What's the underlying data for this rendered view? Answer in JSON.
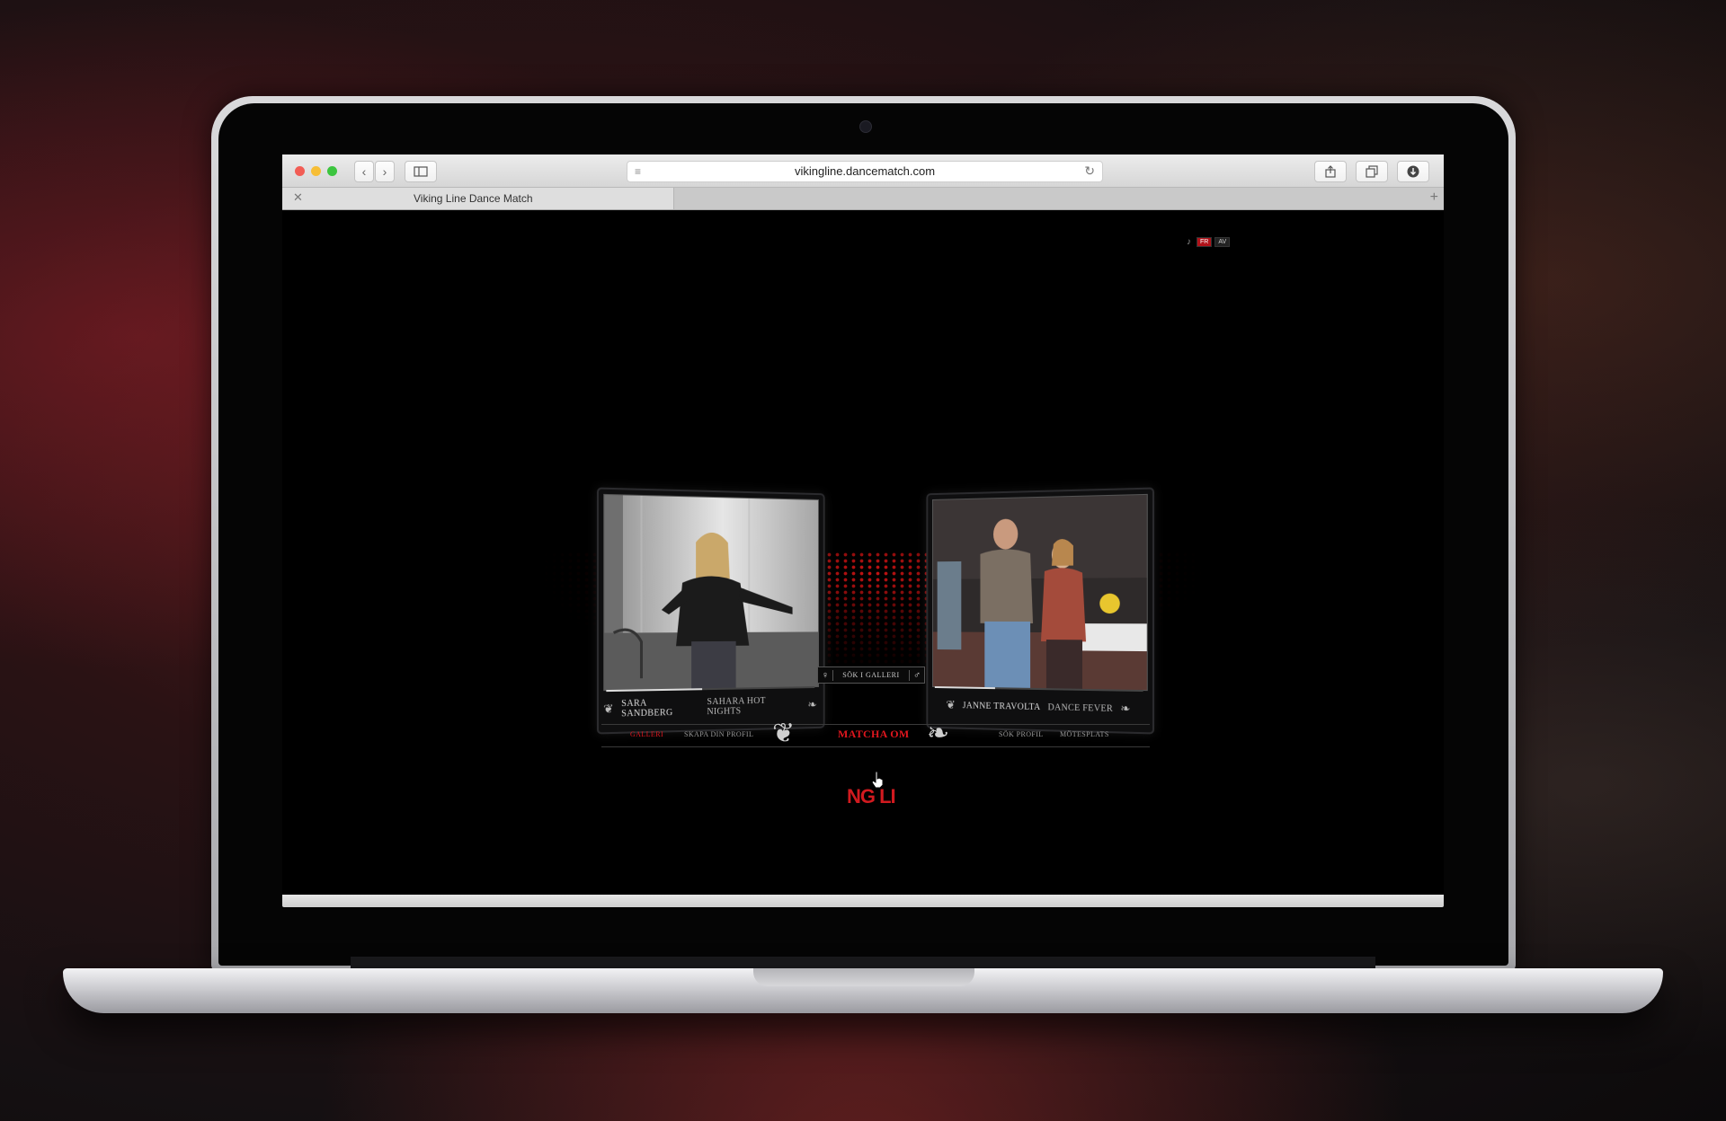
{
  "browser": {
    "url": "vikingline.dancematch.com",
    "tab_title": "Viking Line Dance Match",
    "icons": {
      "back": "chevron-left-icon",
      "forward": "chevron-right-icon",
      "sidebar": "sidebar-icon",
      "share": "share-icon",
      "tabs": "tabs-overview-icon",
      "download": "download-icon",
      "reload": "reload-icon",
      "reader": "reader-icon"
    }
  },
  "page": {
    "language": {
      "items": [
        "FR",
        "AV"
      ],
      "active": "FR"
    },
    "cards": [
      {
        "dancer": "SARA SANDBERG",
        "song": "SAHARA HOT NIGHTS",
        "progress": 0.45
      },
      {
        "dancer": "JANNE TRAVOLTA",
        "song": "DANCE FEVER",
        "progress": 0.3
      }
    ],
    "search_gallery": "SÖK I GALLERI",
    "nav": {
      "items": [
        "GALLERI",
        "SKAPA DIN PROFIL",
        "SÖK PROFIL",
        "MÖTESPLATS"
      ],
      "active": "GALLERI",
      "center": "MATCHA OM"
    },
    "brand_fragment": "NG LI"
  },
  "colors": {
    "accent": "#e0161e",
    "stage": "#c8101a"
  }
}
